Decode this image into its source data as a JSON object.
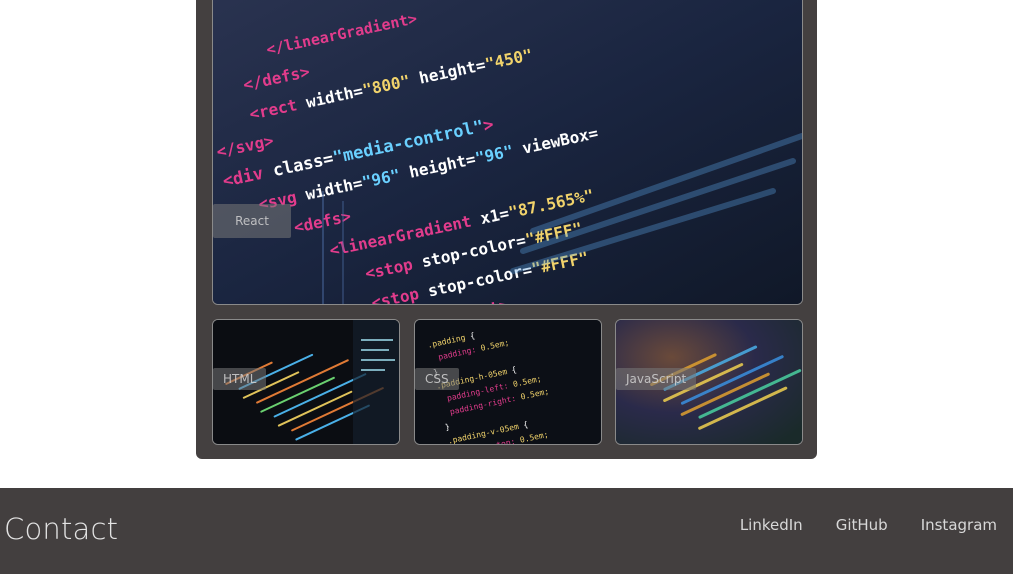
{
  "gallery": {
    "main": {
      "tag": "React"
    },
    "thumbs": [
      {
        "tag": "HTML"
      },
      {
        "tag": "CSS"
      },
      {
        "tag": "JavaScript"
      }
    ]
  },
  "footer": {
    "title": "Contact",
    "links": [
      "LinkedIn",
      "GitHub",
      "Instagram"
    ]
  }
}
